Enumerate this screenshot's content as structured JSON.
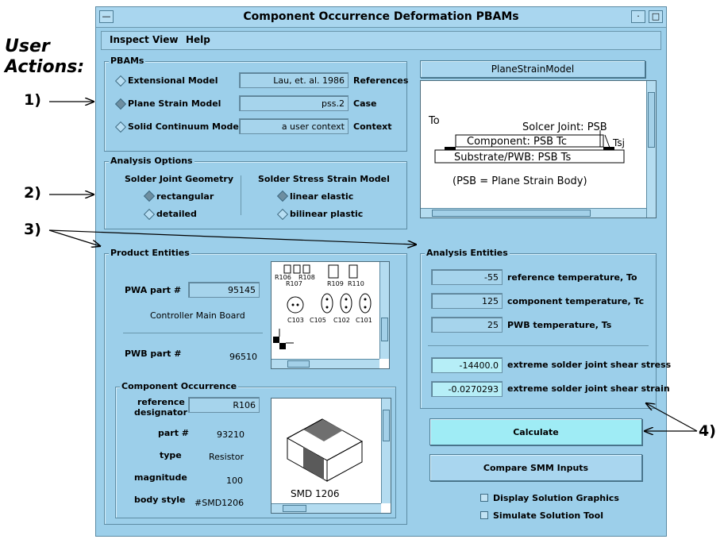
{
  "annotations": {
    "title_line1": "User",
    "title_line2": "Actions:",
    "step1": "1)",
    "step2": "2)",
    "step3": "3)",
    "step4": "4)"
  },
  "window": {
    "title": "Component Occurrence Deformation PBAMs"
  },
  "menu": {
    "items": [
      "Inspect",
      "View",
      "Help"
    ]
  },
  "pbams": {
    "label": "PBAMs",
    "rows": [
      {
        "name": "Extensional Model",
        "selected": false,
        "value": "Lau, et. al. 1986",
        "side_label": "References"
      },
      {
        "name": "Plane Strain Model",
        "selected": true,
        "value": "pss.2",
        "side_label": "Case"
      },
      {
        "name": "Solid Continuum Model",
        "selected": false,
        "value": "a user context",
        "side_label": "Context"
      }
    ]
  },
  "analysis_options": {
    "label": "Analysis Options",
    "geometry": {
      "heading": "Solder Joint Geometry",
      "opt1": "rectangular",
      "opt2": "detailed"
    },
    "model": {
      "heading": "Solder Stress  Strain Model",
      "opt1": "linear elastic",
      "opt2": "bilinear plastic"
    }
  },
  "plane_strain": {
    "header": "PlaneStrainModel",
    "to_label": "To",
    "joint_label": "Solcer Joint: PSB",
    "component_label": "Component: PSB  Tc",
    "tsj_label": "Tsj",
    "substrate_label": "Substrate/PWB: PSB  Ts",
    "note": "(PSB = Plane Strain Body)"
  },
  "product_entities": {
    "label": "Product Entities",
    "pwa_label": "PWA part #",
    "pwa_value": "95145",
    "pwa_desc": "Controller Main Board",
    "pwb_label": "PWB part #",
    "pwb_value": "96510",
    "board_labels": [
      "R106",
      "R108",
      "R107",
      "R109",
      "R110",
      "C103",
      "C105",
      "C102",
      "C101"
    ]
  },
  "component_occurrence": {
    "label": "Component Occurrence",
    "ref_label_line1": "reference",
    "ref_label_line2": "designator",
    "ref_value": "R106",
    "part_label": "part #",
    "part_value": "93210",
    "type_label": "type",
    "type_value": "Resistor",
    "magnitude_label": "magnitude",
    "magnitude_value": "100",
    "body_style_label": "body style",
    "body_style_value": "#SMD1206",
    "image_caption": "SMD 1206"
  },
  "analysis_entities": {
    "label": "Analysis Entities",
    "rows": [
      {
        "value": "-55",
        "label": "reference temperature, To"
      },
      {
        "value": "125",
        "label": "component temperature, Tc"
      },
      {
        "value": "25",
        "label": "PWB temperature, Ts"
      }
    ],
    "results": [
      {
        "value": "-14400.0",
        "label": "extreme solder joint shear stress"
      },
      {
        "value": "-0.0270293",
        "label": "extreme solder joint shear strain"
      }
    ]
  },
  "actions": {
    "calculate": "Calculate",
    "compare": "Compare SMM Inputs",
    "display_graphics": "Display Solution Graphics",
    "simulate_tool": "Simulate Solution Tool"
  }
}
